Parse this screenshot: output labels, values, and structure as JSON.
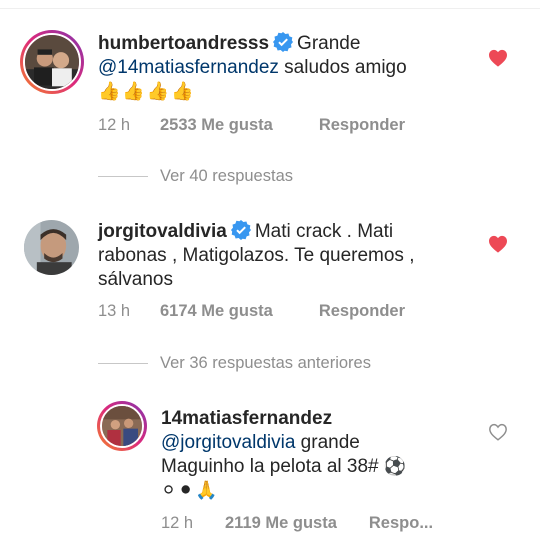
{
  "colors": {
    "heart_filled": "#ed4956",
    "mention": "#00376b",
    "verified": "#3897f0",
    "muted": "#8e8e8e"
  },
  "comments": [
    {
      "username": "humbertoandresss",
      "text_line1": "Grande",
      "mention": "@14matiasfernandez",
      "text_after_mention": " saludos amigo",
      "emoji": "👍👍👍👍",
      "time": "12 h",
      "likes": "2533 Me gusta",
      "reply": "Responder",
      "liked": true,
      "verified": true,
      "view_replies": "Ver 40 respuestas"
    },
    {
      "username": "jorgitovaldivia",
      "text_line1": "Mati crack . Mati",
      "text_line2": "rabonas , Matigolazos. Te queremos ,",
      "text_line3": "sálvanos",
      "time": "13 h",
      "likes": "6174 Me gusta",
      "reply": "Responder",
      "liked": true,
      "verified": true,
      "view_replies": "Ver 36 respuestas anteriores"
    },
    {
      "username": "14matiasfernandez",
      "mention": "@jorgitovaldivia",
      "text_after_mention": " grande",
      "text_line2": "Maguinho la pelota al 38#",
      "emoji_inline": "⚽",
      "emoji_line3": "⚪⚫🙏",
      "time": "12 h",
      "likes": "2119 Me gusta",
      "reply": "Respo...",
      "liked": false,
      "verified": false
    }
  ]
}
